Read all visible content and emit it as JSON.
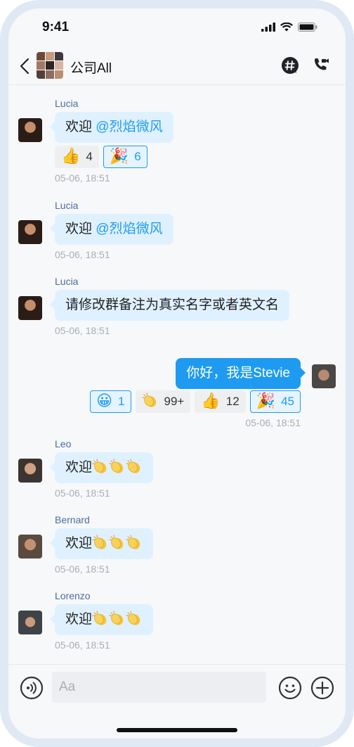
{
  "status": {
    "time": "9:41"
  },
  "header": {
    "title": "公司All"
  },
  "messages": [
    {
      "sender": "Lucia",
      "text": "欢迎 ",
      "mention": "@烈焰微风",
      "time": "05-06, 18:51",
      "reactions": [
        {
          "emoji": "thumbs-up",
          "count": "4"
        },
        {
          "emoji": "party-popper",
          "count": "6"
        }
      ]
    },
    {
      "sender": "Lucia",
      "text": "欢迎 ",
      "mention": "@烈焰微风",
      "time": "05-06, 18:51"
    },
    {
      "sender": "Lucia",
      "text": "请修改群备注为真实名字或者英文名",
      "time": "05-06, 18:51"
    },
    {
      "sender": "Stevie",
      "text": "你好，我是Stevie",
      "time": "05-06, 18:51",
      "reactions": [
        {
          "emoji": "grinning-face",
          "count": "1"
        },
        {
          "emoji": "clapping-hands",
          "count": "99+"
        },
        {
          "emoji": "thumbs-up",
          "count": "12"
        },
        {
          "emoji": "party-popper",
          "count": "45"
        }
      ]
    },
    {
      "sender": "Leo",
      "text": "欢迎",
      "time": "05-06, 18:51"
    },
    {
      "sender": "Bernard",
      "text": "欢迎",
      "time": "05-06, 18:51"
    },
    {
      "sender": "Lorenzo",
      "text": "欢迎",
      "time": "05-06, 18:51"
    }
  ],
  "input": {
    "placeholder": "Aa"
  },
  "colors": {
    "accent": "#1e9bf0",
    "incoming_bubble": "#dff1ff",
    "sender_name": "#4a6da0"
  }
}
